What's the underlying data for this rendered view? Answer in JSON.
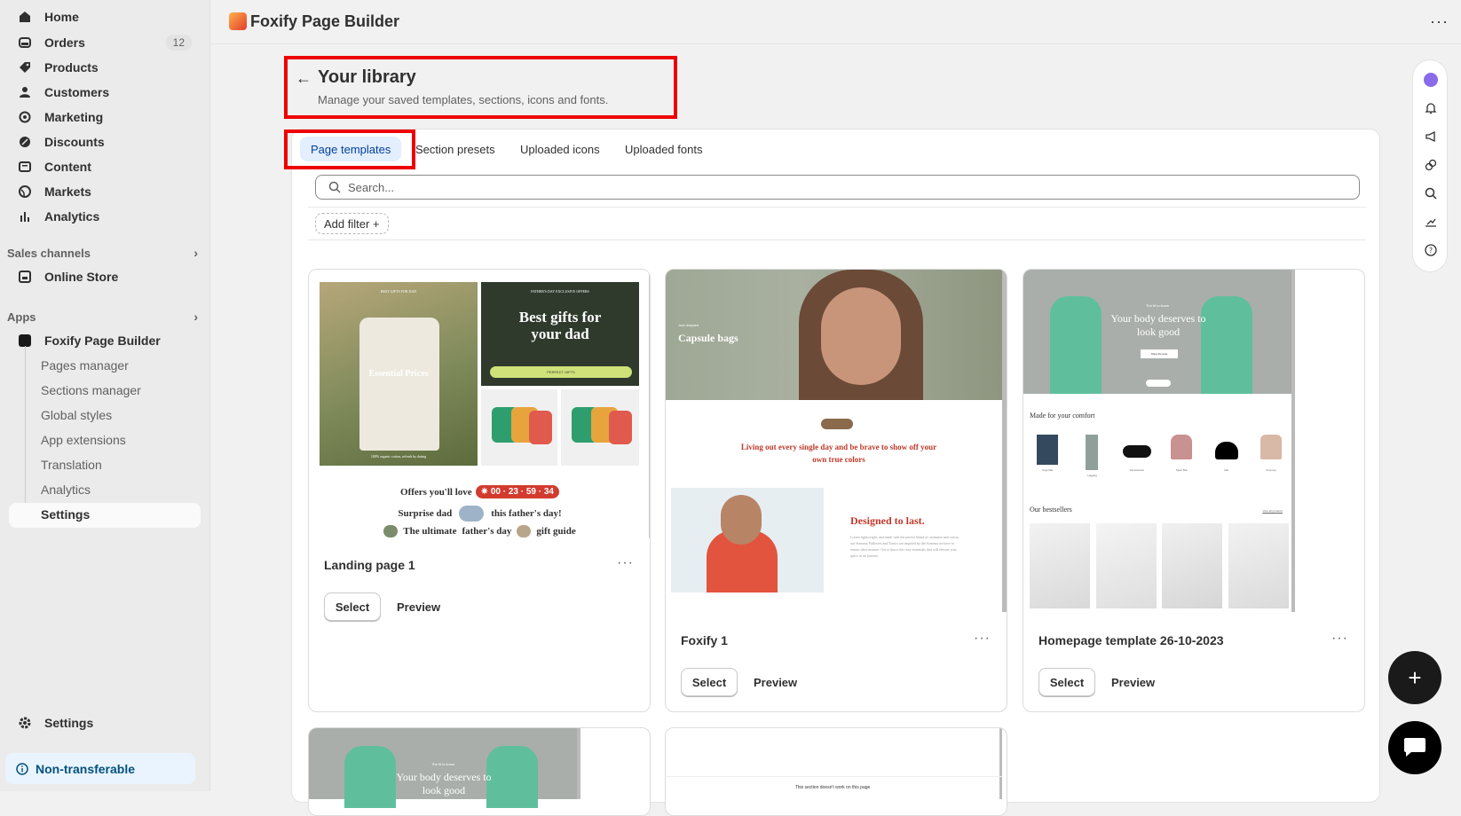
{
  "sidebar": {
    "main_items": [
      {
        "label": "Home",
        "icon": "home-icon"
      },
      {
        "label": "Orders",
        "icon": "inbox-icon",
        "badge": "12"
      },
      {
        "label": "Products",
        "icon": "tag-icon"
      },
      {
        "label": "Customers",
        "icon": "person-icon"
      },
      {
        "label": "Marketing",
        "icon": "target-icon"
      },
      {
        "label": "Discounts",
        "icon": "discount-icon"
      },
      {
        "label": "Content",
        "icon": "content-icon"
      },
      {
        "label": "Markets",
        "icon": "globe-icon"
      },
      {
        "label": "Analytics",
        "icon": "bar-chart-icon"
      }
    ],
    "sales_channels_label": "Sales channels",
    "online_store": "Online Store",
    "apps_label": "Apps",
    "app_name": "Foxify Page Builder",
    "app_sub_items": [
      "Pages manager",
      "Sections manager",
      "Global styles",
      "App extensions",
      "Translation",
      "Analytics",
      "Settings"
    ],
    "settings": "Settings",
    "non_transferable": "Non-transferable"
  },
  "topbar": {
    "app_title": "Foxify Page Builder"
  },
  "header": {
    "title": "Your library",
    "subtitle": "Manage your saved templates, sections, icons and fonts."
  },
  "tabs": [
    "Page templates",
    "Section presets",
    "Uploaded icons",
    "Uploaded fonts"
  ],
  "search": {
    "placeholder": "Search..."
  },
  "filter": {
    "label": "Add filter +"
  },
  "cards": [
    {
      "name": "Landing page 1",
      "select": "Select",
      "preview": "Preview",
      "thumb": {
        "tag1": "BEST GIFTS FOR DAD",
        "headline1": "Essential Prices",
        "caption1": "100% organic cotton, refresh by dating",
        "tag2": "FATHER'S DAY EXCLUSIVE OFFERS",
        "headline2": "Best gifts for your dad",
        "button2": "PERFECT GIFTS",
        "offers": "Offers you'll love",
        "timer": "✷ 00 · 23 · 59 · 34",
        "line2a": "Surprise dad",
        "line2b": "this father's day!",
        "line3a": "The ultimate",
        "line3b": "father's day",
        "line3c": "gift guide"
      }
    },
    {
      "name": "Foxify 1",
      "select": "Select",
      "preview": "Preview",
      "thumb": {
        "tag": "Just dropped",
        "headline": "Capsule bags",
        "tagline": "Living out every single day and be brave to show off your own true colors",
        "designed": "Designed to last.",
        "body": "Lorem lightweight, and made with the perfect blend of cashmere and cotton, our Sonoma Pullovers and Tunics are inspired by the Sonoma we have to ensure ultra treasure. Get to know the cozy essentials that will elevate your space in no journey."
      }
    },
    {
      "name": "Homepage template 26-10-2023",
      "select": "Select",
      "preview": "Preview",
      "thumb": {
        "tag": "The fit to know",
        "headline": "Your body deserves to look good",
        "button": "Shop the look",
        "made": "Made for your comfort",
        "categories": [
          "Yoga Mat",
          "Legging",
          "Accessories",
          "Sport Bra",
          "Hat",
          "Crop top"
        ],
        "bestsellers": "Our bestsellers",
        "view_all": "View all products"
      }
    }
  ],
  "bottom_cards": [
    {
      "tag": "The fit to know",
      "headline": "Your body deserves to look good"
    },
    {
      "notice": "This section doesn't work on this page"
    }
  ],
  "colors": {
    "accent": "#004299",
    "highlight": "#ee0000",
    "foxify_red": "#c0392b",
    "mint": "#5fbf9c"
  }
}
